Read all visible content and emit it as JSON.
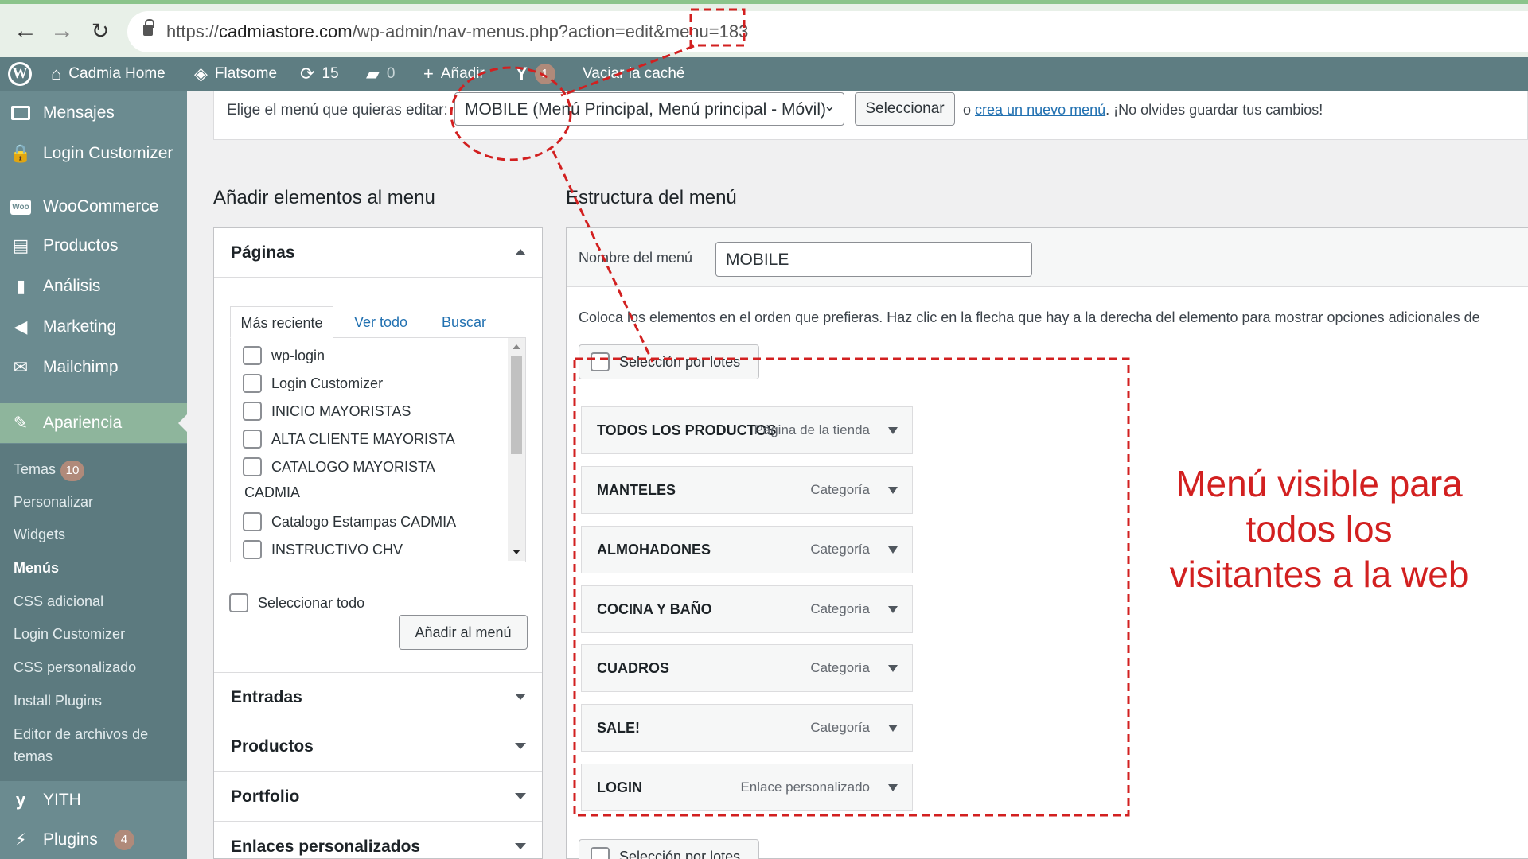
{
  "browser": {
    "url_prefix": "https://",
    "url_host": "cadmiastore.com",
    "url_path": "/wp-admin/nav-menus.php?action=edit&menu=183"
  },
  "adminbar": {
    "site": "Cadmia Home",
    "theme": "Flatsome",
    "updates": "15",
    "comments": "0",
    "add_new": "Añadir",
    "yoast_count": "1",
    "clear_cache": "Vaciar la caché"
  },
  "sidebar": {
    "items": [
      {
        "label": "Mensajes",
        "icon": "messages-icon"
      },
      {
        "label": "Login Customizer",
        "icon": "lock-icon"
      },
      {
        "label": "WooCommerce",
        "icon": "woocommerce-icon"
      },
      {
        "label": "Productos",
        "icon": "archive-icon"
      },
      {
        "label": "Análisis",
        "icon": "bar-chart-icon"
      },
      {
        "label": "Marketing",
        "icon": "megaphone-icon"
      },
      {
        "label": "Mailchimp",
        "icon": "mailchimp-icon"
      },
      {
        "label": "Apariencia",
        "icon": "paintbrush-icon"
      },
      {
        "label": "YITH",
        "icon": "yith-icon"
      },
      {
        "label": "Plugins",
        "icon": "plugin-icon",
        "badge": "4"
      }
    ],
    "submenu": [
      {
        "label": "Temas",
        "badge": "10"
      },
      {
        "label": "Personalizar"
      },
      {
        "label": "Widgets"
      },
      {
        "label": "Menús"
      },
      {
        "label": "CSS adicional"
      },
      {
        "label": "Login Customizer"
      },
      {
        "label": "CSS personalizado"
      },
      {
        "label": "Install Plugins"
      },
      {
        "label": "Editor de archivos de"
      },
      {
        "label": "temas"
      }
    ]
  },
  "select_row": {
    "label": "Elige el menú que quieras editar:",
    "selected": "MOBILE (Menú Principal, Menú principal - Móvil)",
    "button": "Seleccionar",
    "or": "o",
    "create_link": "crea un nuevo menú",
    "reminder": ". ¡No olvides guardar tus cambios!"
  },
  "left": {
    "title": "Añadir elementos al menu",
    "pages_header": "Páginas",
    "tabs": [
      "Más reciente",
      "Ver todo",
      "Buscar"
    ],
    "pages": [
      "wp-login",
      "Login Customizer",
      "INICIO MAYORISTAS",
      "ALTA CLIENTE MAYORISTA",
      "CATALOGO MAYORISTA",
      "CADMIA",
      "Catalogo Estampas CADMIA",
      "INSTRUCTIVO CHV"
    ],
    "select_all": "Seleccionar todo",
    "add_button": "Añadir al menú",
    "sections": [
      "Entradas",
      "Productos",
      "Portfolio",
      "Enlaces personalizados"
    ]
  },
  "right": {
    "title": "Estructura del menú",
    "name_label": "Nombre del menú",
    "name_value": "MOBILE",
    "instructions": "Coloca los elementos en el orden que prefieras. Haz clic en la flecha que hay a la derecha del elemento para mostrar opciones adicionales de",
    "bulk": "Selección por lotes",
    "items": [
      {
        "title": "TODOS LOS PRODUCTOS",
        "type": "Página de la tienda"
      },
      {
        "title": "MANTELES",
        "type": "Categoría"
      },
      {
        "title": "ALMOHADONES",
        "type": "Categoría"
      },
      {
        "title": "COCINA Y BAÑO",
        "type": "Categoría"
      },
      {
        "title": "CUADROS",
        "type": "Categoría"
      },
      {
        "title": "SALE!",
        "type": "Categoría"
      },
      {
        "title": "LOGIN",
        "type": "Enlace personalizado"
      }
    ]
  },
  "annotation": {
    "line1": "Menú visible para",
    "line2": "todos los",
    "line3": "visitantes a la web",
    "color": "#d22020"
  }
}
